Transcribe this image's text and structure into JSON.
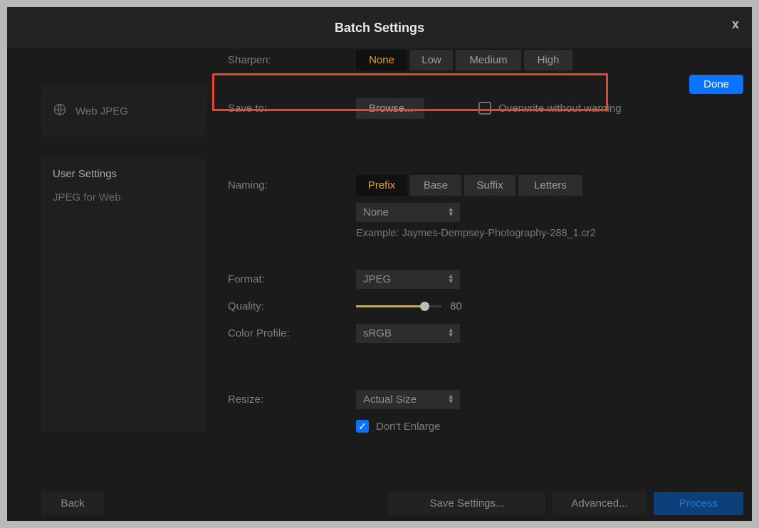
{
  "title": "Batch Settings",
  "close_glyph": "x",
  "done_label": "Done",
  "sidebar": {
    "preset": {
      "label": "Web JPEG"
    },
    "user_settings_header": "User Settings",
    "user_settings_items": [
      "JPEG for Web"
    ]
  },
  "sharpen": {
    "label": "Sharpen:",
    "options": [
      "None",
      "Low",
      "Medium",
      "High"
    ],
    "selected": "None"
  },
  "save_to": {
    "label": "Save to:",
    "browse_label": "Browse...",
    "overwrite_label": "Overwrite without warning",
    "overwrite_checked": false
  },
  "naming": {
    "label": "Naming:",
    "options": [
      "Prefix",
      "Base",
      "Suffix",
      "Letters"
    ],
    "selected": "Prefix",
    "dropdown_value": "None",
    "example_prefix": "Example: ",
    "example_value": "Jaymes-Dempsey-Photography-288_1.cr2"
  },
  "format": {
    "label": "Format:",
    "value": "JPEG"
  },
  "quality": {
    "label": "Quality:",
    "value": 80,
    "min": 0,
    "max": 100
  },
  "color_profile": {
    "label": "Color Profile:",
    "value": "sRGB"
  },
  "resize": {
    "label": "Resize:",
    "value": "Actual Size",
    "dont_enlarge_label": "Don't Enlarge",
    "dont_enlarge_checked": true
  },
  "footer": {
    "back": "Back",
    "save_settings": "Save Settings...",
    "advanced": "Advanced...",
    "process": "Process"
  }
}
